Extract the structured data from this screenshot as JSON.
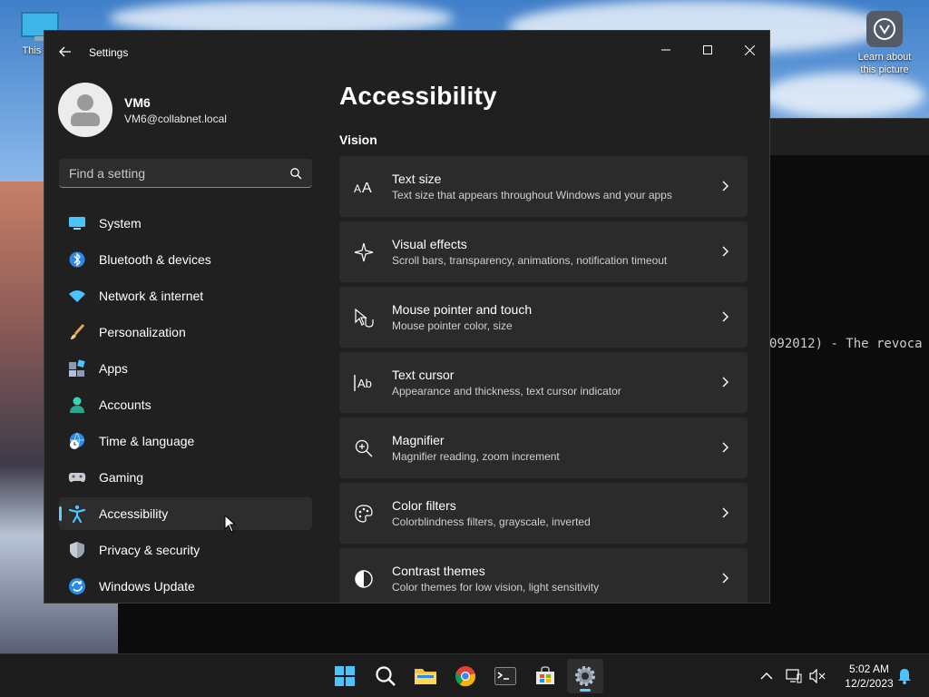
{
  "desktop": {
    "icons": [
      {
        "label": "This PC",
        "name": "this-pc"
      },
      {
        "label": "Learn about this picture",
        "name": "learn-about-picture"
      }
    ]
  },
  "terminal": {
    "line": "092012) - The revoca"
  },
  "settings_window": {
    "app_title": "Settings",
    "profile": {
      "name": "VM6",
      "email": "VM6@collabnet.local"
    },
    "search": {
      "placeholder": "Find a setting"
    },
    "nav": [
      {
        "label": "System",
        "icon": "system-icon",
        "active": false
      },
      {
        "label": "Bluetooth & devices",
        "icon": "bluetooth-icon",
        "active": false
      },
      {
        "label": "Network & internet",
        "icon": "wifi-icon",
        "active": false
      },
      {
        "label": "Personalization",
        "icon": "brush-icon",
        "active": false
      },
      {
        "label": "Apps",
        "icon": "apps-icon",
        "active": false
      },
      {
        "label": "Accounts",
        "icon": "accounts-icon",
        "active": false
      },
      {
        "label": "Time & language",
        "icon": "globe-clock-icon",
        "active": false
      },
      {
        "label": "Gaming",
        "icon": "gamepad-icon",
        "active": false
      },
      {
        "label": "Accessibility",
        "icon": "accessibility-icon",
        "active": true
      },
      {
        "label": "Privacy & security",
        "icon": "shield-icon",
        "active": false
      },
      {
        "label": "Windows Update",
        "icon": "update-icon",
        "active": false
      }
    ],
    "page_title": "Accessibility",
    "section_title": "Vision",
    "cards": [
      {
        "title": "Text size",
        "subtitle": "Text size that appears throughout Windows and your apps",
        "icon": "text-size-icon"
      },
      {
        "title": "Visual effects",
        "subtitle": "Scroll bars, transparency, animations, notification timeout",
        "icon": "sparkle-icon"
      },
      {
        "title": "Mouse pointer and touch",
        "subtitle": "Mouse pointer color, size",
        "icon": "pointer-touch-icon"
      },
      {
        "title": "Text cursor",
        "subtitle": "Appearance and thickness, text cursor indicator",
        "icon": "text-cursor-icon"
      },
      {
        "title": "Magnifier",
        "subtitle": "Magnifier reading, zoom increment",
        "icon": "magnifier-icon"
      },
      {
        "title": "Color filters",
        "subtitle": "Colorblindness filters, grayscale, inverted",
        "icon": "palette-icon"
      },
      {
        "title": "Contrast themes",
        "subtitle": "Color themes for low vision, light sensitivity",
        "icon": "contrast-icon"
      }
    ]
  },
  "taskbar": {
    "apps": [
      "start-icon",
      "search-icon",
      "file-explorer-icon",
      "chrome-icon",
      "terminal-icon",
      "store-icon",
      "settings-icon"
    ],
    "active_app": "settings-icon",
    "time": "5:02 AM",
    "date": "12/2/2023"
  },
  "colors": {
    "accent": "#60cdff",
    "window_bg": "#202020",
    "card_bg": "#2b2b2b"
  }
}
